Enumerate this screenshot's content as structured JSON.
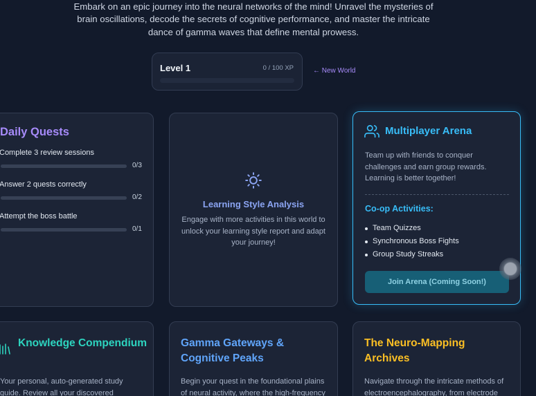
{
  "intro": {
    "line1": "Embark on an epic journey into the neural networks of the mind! Unravel the mysteries of",
    "line2": "brain oscillations, decode the secrets of cognitive performance, and master the intricate",
    "line3": "dance of gamma waves that define mental prowess."
  },
  "level": {
    "title": "Level 1",
    "xp": "0 / 100 XP",
    "progress": 0
  },
  "new_world": "← New World",
  "daily_quests": {
    "title": "Daily Quests",
    "items": [
      {
        "label": "Complete 3 review sessions",
        "count": "0/3",
        "progress": 0
      },
      {
        "label": "Answer 2 quests correctly",
        "count": "0/2",
        "progress": 0
      },
      {
        "label": "Attempt the boss battle",
        "count": "0/1",
        "progress": 0
      }
    ]
  },
  "learning_style": {
    "icon": "sun-icon",
    "title": "Learning Style Analysis",
    "body": "Engage with more activities in this world to unlock your learning style report and adapt your journey!"
  },
  "multiplayer": {
    "icon": "users-icon",
    "title": "Multiplayer Arena",
    "body": "Team up with friends to conquer challenges and earn group rewards. Learning is better together!",
    "subtitle": "Co-op Activities:",
    "activities": [
      "Team Quizzes",
      "Synchronous Boss Fights",
      "Group Study Streaks"
    ],
    "button": "Join Arena (Coming Soon!)"
  },
  "bottom_cards": [
    {
      "title": "Knowledge Compendium",
      "body": "Your personal, auto-generated study guide. Review all your discovered",
      "color": "#2dd4bf",
      "icon": "book-stack-icon"
    },
    {
      "title": "Gamma Gateways & Cognitive Peaks",
      "body": "Begin your quest in the foundational plains of neural activity, where the high-frequency rhythms of gamma oscillations",
      "color": "#60a5fa"
    },
    {
      "title": "The Neuro-Mapping Archives",
      "body": "Navigate through the intricate methods of electroencephalography, from electrode placement to data",
      "color": "#fbbf24"
    }
  ],
  "colors": {
    "background": "#121a2b",
    "quests_accent": "#a78bfa",
    "multiplayer_accent": "#38bdf8"
  }
}
